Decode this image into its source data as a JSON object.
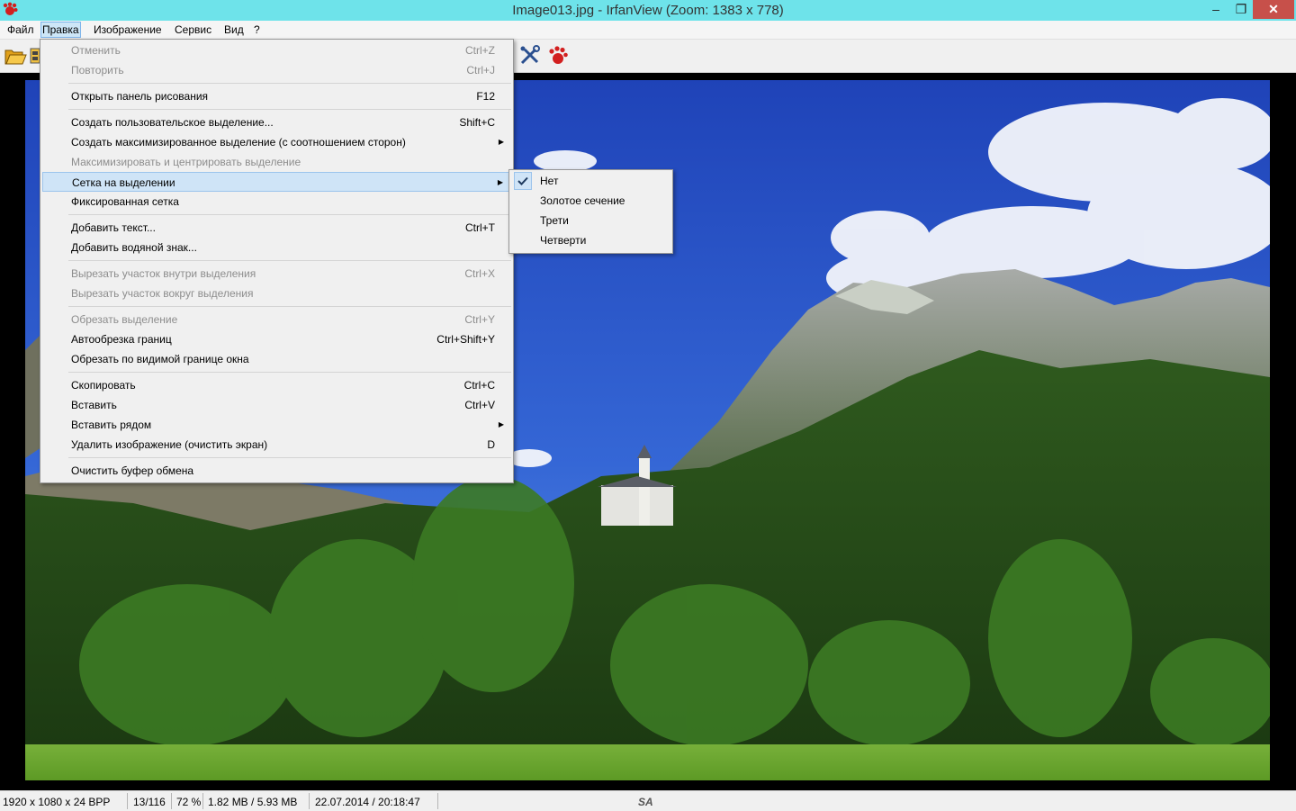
{
  "window": {
    "title": "Image013.jpg - IrfanView (Zoom: 1383 x 778)",
    "controls": {
      "minimize": "‒",
      "maximize": "❐",
      "close": "✕"
    }
  },
  "menubar": {
    "items": [
      {
        "label": "Файл"
      },
      {
        "label": "Правка"
      },
      {
        "label": "Изображение"
      },
      {
        "label": "Сервис"
      },
      {
        "label": "Вид"
      },
      {
        "label": "?"
      }
    ]
  },
  "toolbar": {
    "icons": [
      "open-folder-icon",
      "slideshow-icon",
      "settings-tools-icon",
      "irfanview-paws-icon"
    ]
  },
  "edit_menu": {
    "items": [
      {
        "label": "Отменить",
        "shortcut": "Ctrl+Z",
        "disabled": true
      },
      {
        "label": "Повторить",
        "shortcut": "Ctrl+J",
        "disabled": true
      },
      {
        "label": "Открыть панель рисования",
        "shortcut": "F12"
      },
      {
        "label": "Создать пользовательское выделение...",
        "shortcut": "Shift+C"
      },
      {
        "label": "Создать максимизированное выделение (с соотношением сторон)",
        "shortcut": "",
        "submenu": true
      },
      {
        "label": "Максимизировать и центрировать выделение",
        "shortcut": "",
        "disabled": true
      },
      {
        "label": "Сетка на выделении",
        "shortcut": "",
        "submenu": true,
        "highlight": true
      },
      {
        "label": "Фиксированная сетка",
        "shortcut": ""
      },
      {
        "label": "Добавить текст...",
        "shortcut": "Ctrl+T"
      },
      {
        "label": "Добавить водяной знак...",
        "shortcut": ""
      },
      {
        "label": "Вырезать участок внутри выделения",
        "shortcut": "Ctrl+X",
        "disabled": true
      },
      {
        "label": "Вырезать участок вокруг выделения",
        "shortcut": "",
        "disabled": true
      },
      {
        "label": "Обрезать выделение",
        "shortcut": "Ctrl+Y",
        "disabled": true
      },
      {
        "label": "Автообрезка границ",
        "shortcut": "Ctrl+Shift+Y"
      },
      {
        "label": "Обрезать по видимой границе окна",
        "shortcut": ""
      },
      {
        "label": "Скопировать",
        "shortcut": "Ctrl+C"
      },
      {
        "label": "Вставить",
        "shortcut": "Ctrl+V"
      },
      {
        "label": "Вставить рядом",
        "shortcut": "",
        "submenu": true
      },
      {
        "label": "Удалить изображение (очистить экран)",
        "shortcut": "D"
      },
      {
        "label": "Очистить буфер обмена",
        "shortcut": ""
      }
    ]
  },
  "grid_submenu": {
    "items": [
      {
        "label": "Нет",
        "checked": true
      },
      {
        "label": "Золотое сечение"
      },
      {
        "label": "Трети"
      },
      {
        "label": "Четверти"
      }
    ]
  },
  "statusbar": {
    "dimensions": "1920 x 1080 x 24 BPP",
    "index": "13/116",
    "zoom": "72 %",
    "size": "1.82 MB / 5.93 MB",
    "datetime": "22.07.2014 / 20:18:47",
    "badge": "SA"
  },
  "colors": {
    "titlebar": "#6ee3ea",
    "menu_highlight": "#cfe4f7",
    "close_button": "#c7504a"
  }
}
